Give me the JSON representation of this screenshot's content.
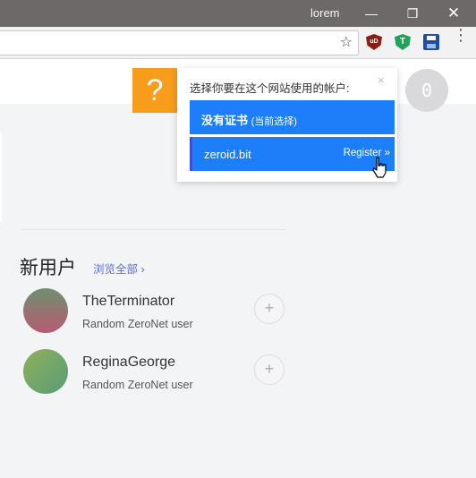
{
  "window": {
    "title": "lorem",
    "minimize": "—",
    "restore": "❐",
    "close": "✕"
  },
  "toolbar": {
    "bookmark_star": "☆",
    "extensions": [
      {
        "name": "ublock-icon",
        "glyph": "uD"
      },
      {
        "name": "t-shield-icon",
        "glyph": "T"
      },
      {
        "name": "save-disk-icon",
        "glyph": ""
      }
    ],
    "menu": "⋮"
  },
  "page": {
    "help_glyph": "?",
    "notification_count": "0",
    "popup": {
      "heading": "选择你要在这个网站使用的帐户:",
      "close": "×",
      "certs": [
        {
          "name": "没有证书",
          "note": "(当前选择)",
          "action": ""
        },
        {
          "name": "zeroid.bit",
          "note": "",
          "action": "Register »"
        }
      ]
    },
    "new_users": {
      "title": "新用户",
      "browse_all": "浏览全部 ›",
      "users": [
        {
          "name": "TheTerminator",
          "description": "Random ZeroNet user",
          "follow": "+"
        },
        {
          "name": "ReginaGeorge",
          "description": "Random ZeroNet user",
          "follow": "+"
        }
      ]
    }
  },
  "colors": {
    "accent_blue": "#1c7ff9",
    "help_orange": "#f89c1c",
    "titlebar": "#6d6969",
    "link": "#5a6ee0"
  }
}
